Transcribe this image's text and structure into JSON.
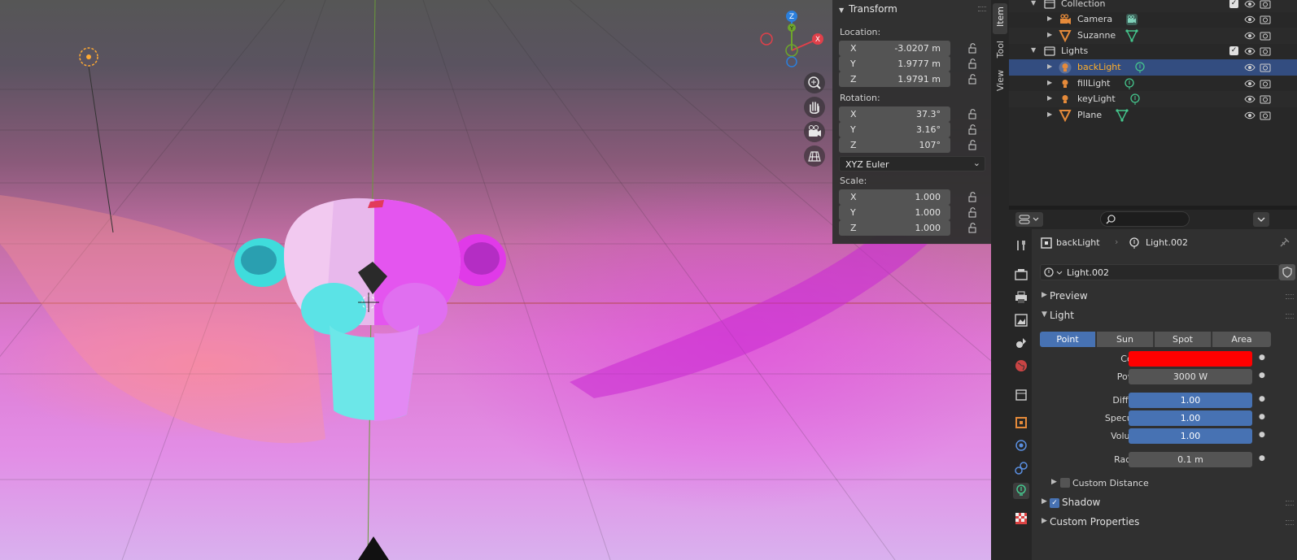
{
  "viewport": {
    "gizmo_axes": {
      "z": "Z",
      "y": "Y",
      "x": "X"
    }
  },
  "npanel": {
    "title": "Transform",
    "location_label": "Location:",
    "location": [
      {
        "axis": "X",
        "value": "-3.0207 m"
      },
      {
        "axis": "Y",
        "value": "1.9777 m"
      },
      {
        "axis": "Z",
        "value": "1.9791 m"
      }
    ],
    "rotation_label": "Rotation:",
    "rotation": [
      {
        "axis": "X",
        "value": "37.3°"
      },
      {
        "axis": "Y",
        "value": "3.16°"
      },
      {
        "axis": "Z",
        "value": "107°"
      }
    ],
    "rotation_mode": "XYZ Euler",
    "scale_label": "Scale:",
    "scale": [
      {
        "axis": "X",
        "value": "1.000"
      },
      {
        "axis": "Y",
        "value": "1.000"
      },
      {
        "axis": "Z",
        "value": "1.000"
      }
    ],
    "tabs": [
      "Item",
      "Tool",
      "View"
    ]
  },
  "outliner": {
    "rows": [
      {
        "label": "Collection",
        "type": "collection"
      },
      {
        "label": "Camera",
        "type": "camera"
      },
      {
        "label": "Suzanne",
        "type": "mesh"
      },
      {
        "label": "Lights",
        "type": "collection"
      },
      {
        "label": "backLight",
        "type": "light",
        "selected": true
      },
      {
        "label": "fillLight",
        "type": "light"
      },
      {
        "label": "keyLight",
        "type": "light"
      },
      {
        "label": "Plane",
        "type": "mesh"
      }
    ]
  },
  "properties": {
    "breadcrumb_object": "backLight",
    "breadcrumb_data": "Light.002",
    "datablock_name": "Light.002",
    "panels": {
      "preview": "Preview",
      "light": "Light",
      "shadow": "Shadow",
      "custom_properties": "Custom Properties"
    },
    "light_types": [
      "Point",
      "Sun",
      "Spot",
      "Area"
    ],
    "active_light_type": "Point",
    "color_label": "Color",
    "color_value": "#ff0000",
    "power_label": "Power",
    "power_value": "3000 W",
    "diffuse_label": "Diffuse",
    "diffuse_value": "1.00",
    "specular_label": "Specular",
    "specular_value": "1.00",
    "volume_label": "Volume",
    "volume_value": "1.00",
    "radius_label": "Radius",
    "radius_value": "0.1 m",
    "custom_distance_label": "Custom Distance",
    "custom_distance_checked": false,
    "shadow_checked": true
  },
  "colors": {
    "accent_blue": "#4772b3",
    "selection_row": "#334d80",
    "active_text": "#ffaf29",
    "light_color": "#ff0000"
  }
}
